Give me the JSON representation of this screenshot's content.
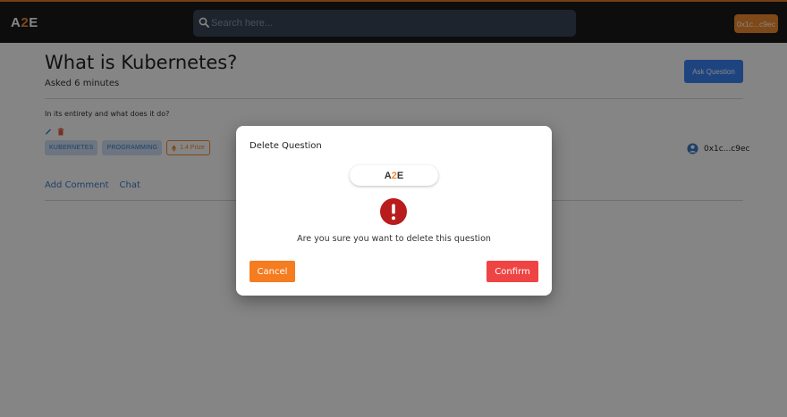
{
  "app": {
    "logo_prefix": "A",
    "logo_two": "2",
    "logo_suffix": "E"
  },
  "header": {
    "search_placeholder": "Search here...",
    "wallet_label": "0x1c...c9ec"
  },
  "question": {
    "title": "What is Kubernetes?",
    "asked": "Asked 6 minutes",
    "ask_button": "Ask Question",
    "body": "In its entirety and what does it do?",
    "tags": [
      "KUBERNETES",
      "PROGRAMMING"
    ],
    "prize": "1.4 Prize",
    "author": "0x1c...c9ec",
    "links": {
      "add_comment": "Add Comment",
      "chat": "Chat"
    }
  },
  "modal": {
    "title": "Delete Question",
    "message": "Are you sure you want to delete this question",
    "cancel": "Cancel",
    "confirm": "Confirm"
  },
  "colors": {
    "brand_orange": "#f28b2f",
    "primary_blue": "#3b82f6",
    "danger_red": "#ef4444",
    "alert_red": "#b91c1c"
  },
  "icons": {
    "search": "search-icon",
    "edit": "pencil-icon",
    "delete": "trash-icon",
    "prize": "ethereum-icon",
    "author": "user-avatar-icon",
    "alert": "exclamation-icon"
  }
}
